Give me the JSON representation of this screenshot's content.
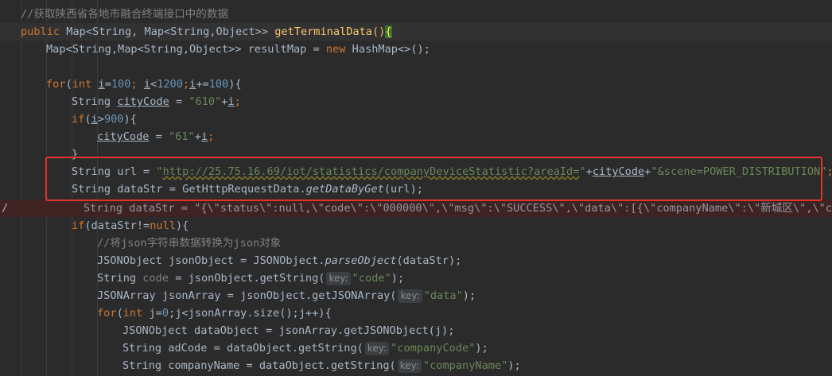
{
  "editor": {
    "lines": {
      "l1": {
        "comment": "//获取陕西省各地市融合终端接口中的数据"
      },
      "l2": {
        "kw_public": "public",
        "type_ret": "Map<String, Map<String,Object>> ",
        "method": "getTerminalData",
        "open_paren": "(",
        "close_paren": ")",
        "brace": "{"
      },
      "l3": {
        "decl": "Map<String,Map<String,Object>> resultMap = ",
        "kw_new": "new",
        "rest": " HashMap<>();"
      },
      "l5": {
        "kw_for": "for",
        "p1": "(",
        "kw_int": "int",
        "sp": " ",
        "var_i": "i",
        "eq": "=",
        "n100": "100",
        "semi1": "; ",
        "var_i2": "i",
        "lt": "<",
        "n1200": "1200",
        "semi2": ";",
        "var_i3": "i",
        "pluseq": "+=",
        "n100b": "100",
        "close": "){"
      },
      "l6": {
        "type": "String ",
        "var": "cityCode",
        "eq": " = ",
        "str": "\"610\"",
        "plus": "+",
        "var_i": "i",
        "semi": ";"
      },
      "l7": {
        "kw_if": "if",
        "p": "(",
        "var_i": "i",
        "gt": ">",
        "n900": "900",
        "close": "){"
      },
      "l8": {
        "var": "cityCode",
        "eq": " = ",
        "str": "\"61\"",
        "plus": "+",
        "var_i": "i",
        "semi": ";"
      },
      "l9": {
        "brace": "}"
      },
      "l10": {
        "decl": "String url = ",
        "q1": "\"",
        "url": "http://25.75.16.69/iot/statistics/companyDeviceStatistic?areaId=",
        "q2": "\"",
        "plus1": "+",
        "var": "cityCode",
        "plus2": "+",
        "str2": "\"&scene=POWER_DISTRIBUTION\"",
        "semi": ";"
      },
      "l11": {
        "decl": "String dataStr = GetHttpRequestData.",
        "method": "getDataByGet",
        "args": "(url);"
      },
      "l12": {
        "marker": "/",
        "text": "String dataStr = \"{\\\"status\\\":null,\\\"code\\\":\\\"000000\\\",\\\"msg\\\":\\\"SUCCESS\\\",\\\"data\\\":[{\\\"companyName\\\":\\\"新城区\\\",\\\"comp"
      },
      "l13": {
        "kw_if": "if",
        "rest": "(dataStr!=",
        "kw_null": "null",
        "close": "){"
      },
      "l14": {
        "comment": "//将json字符串数据转换为json对象"
      },
      "l15": {
        "decl": "JSONObject jsonObject = JSONObject.",
        "method": "parseObject",
        "args": "(dataStr);"
      },
      "l16": {
        "type": "String ",
        "var": "code",
        "mid": " = jsonObject.getString(",
        "hint": "key:",
        "str": "\"code\"",
        "close": ");"
      },
      "l17": {
        "decl": "JSONArray jsonArray = jsonObject.getJSONArray(",
        "hint": "key:",
        "str": "\"data\"",
        "close": ");"
      },
      "l18": {
        "kw_for": "for",
        "p1": "(",
        "kw_int": "int",
        "rest": " j=",
        "n0": "0",
        "rest2": ";j<jsonArray.size();j++){"
      },
      "l19": {
        "decl": "JSONObject dataObject = jsonArray.getJSONObject(j);"
      },
      "l20": {
        "decl": "String adCode = dataObject.getString(",
        "hint": "key:",
        "str": "\"companyCode\"",
        "close": ");"
      },
      "l21": {
        "decl": "String companyName = dataObject.getString(",
        "hint": "key:",
        "str": "\"companyName\"",
        "close": ");"
      }
    }
  }
}
